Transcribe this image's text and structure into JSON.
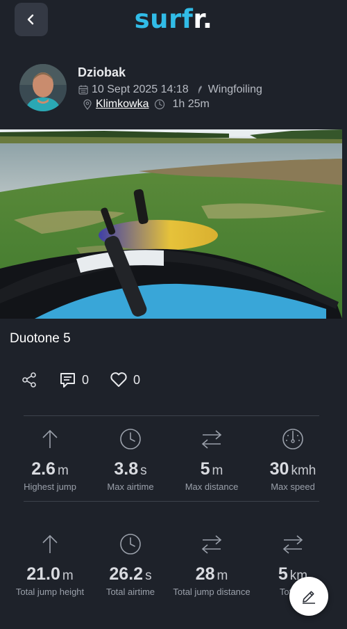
{
  "header": {
    "logo_main": "surf",
    "logo_accent": "r.",
    "back_icon": "chevron-left-icon"
  },
  "session": {
    "username": "Dziobak",
    "date": "10 Sept 2025 14:18",
    "activity": "Wingfoiling",
    "location": "Klimkowka",
    "duration": "1h 25m"
  },
  "equipment": {
    "title": "Duotone 5"
  },
  "actions": {
    "comments_count": "0",
    "likes_count": "0"
  },
  "stats_row1": [
    {
      "value": "2.6",
      "unit": "m",
      "label": "Highest jump",
      "icon": "arrow-up-icon"
    },
    {
      "value": "3.8",
      "unit": "s",
      "label": "Max airtime",
      "icon": "clock-icon"
    },
    {
      "value": "5",
      "unit": "m",
      "label": "Max distance",
      "icon": "arrows-exchange-icon"
    },
    {
      "value": "30",
      "unit": "kmh",
      "label": "Max speed",
      "icon": "speedometer-icon"
    }
  ],
  "stats_row2": [
    {
      "value": "21.0",
      "unit": "m",
      "label": "Total jump height",
      "icon": "arrow-up-icon"
    },
    {
      "value": "26.2",
      "unit": "s",
      "label": "Total airtime",
      "icon": "clock-icon"
    },
    {
      "value": "28",
      "unit": "m",
      "label": "Total jump distance",
      "icon": "arrows-exchange-icon"
    },
    {
      "value": "5",
      "unit": "km",
      "label": "Total d",
      "icon": "arrows-exchange-icon"
    }
  ],
  "colors": {
    "background": "#1e222a",
    "accent": "#31bce7",
    "back_button": "#343944"
  }
}
